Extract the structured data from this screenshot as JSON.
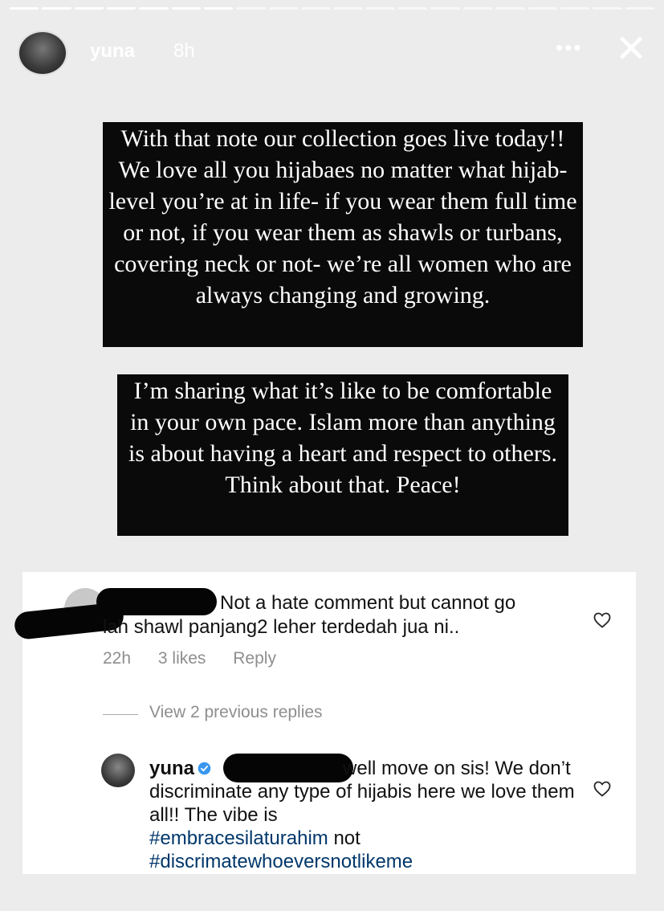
{
  "story": {
    "username": "yuna",
    "time": "8h",
    "progress_total": 20,
    "progress_done": 7
  },
  "captions": [
    "With that note our collection goes live today!! We love all you hijabaes no matter what hijab-level you’re at in life- if you wear them full time or not, if you wear them as shawls or turbans, covering neck or not- we’re all women who are always changing and growing.",
    "I’m sharing what it’s like to be comfortable in your own pace. Islam more than anything is about having a heart and respect to others. Think about that. Peace!"
  ],
  "comment1": {
    "text_line1": "Not a hate comment but cannot go",
    "text_line2": "lah shawl panjang2 leher terdedah jua ni..",
    "time": "22h",
    "likes": "3 likes",
    "reply": "Reply"
  },
  "view_replies": "View 2 previous replies",
  "comment2": {
    "username": "yuna",
    "text": "well move on sis! We don’t discriminate any type of hijabis here we love them all!! The vibe is",
    "hashtag1": "#embracesilaturahim",
    "not_word": "not",
    "hashtag2": "#discrimatewhoeversnotlikeme"
  },
  "icons": {
    "more": "more-icon",
    "close": "close-icon",
    "heart": "heart-icon",
    "verified": "verified-badge-icon"
  },
  "colors": {
    "verified": "#3897f0",
    "hashtag": "#00376b",
    "meta": "#8e8e8e"
  }
}
